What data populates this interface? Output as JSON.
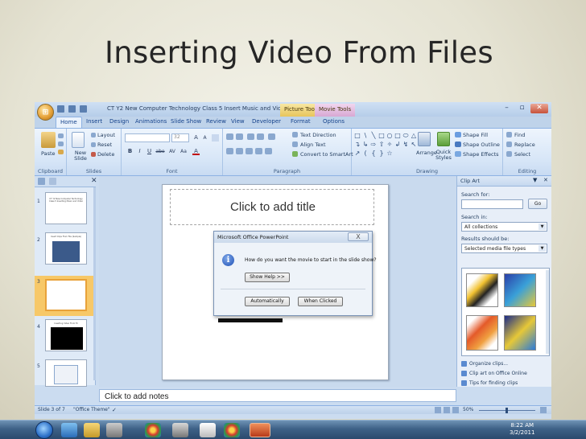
{
  "slide_title": "Inserting Video From Files",
  "window": {
    "title": "CT Y2 New Computer Technology  Class 5 Insert Music and Video ...",
    "context_tabs": [
      "Picture Tools",
      "Movie Tools"
    ],
    "controls": {
      "minimize": "–",
      "maximize": "▫",
      "close": "✕"
    }
  },
  "ribbon_tabs": [
    "Home",
    "Insert",
    "Design",
    "Animations",
    "Slide Show",
    "Review",
    "View",
    "Developer",
    "Format",
    "Options"
  ],
  "ribbon": {
    "clipboard": {
      "paste": "Paste",
      "group": "Clipboard"
    },
    "slides": {
      "new_slide": "New Slide",
      "layout": "Layout",
      "reset": "Reset",
      "delete": "Delete",
      "group": "Slides"
    },
    "font": {
      "size": "32",
      "grow": "A",
      "shrink": "A",
      "bold": "B",
      "italic": "I",
      "underline": "U",
      "strike": "abe",
      "spacing": "AV",
      "case": "Aa",
      "color": "A",
      "group": "Font"
    },
    "paragraph": {
      "text_direction": "Text Direction",
      "align_text": "Align Text",
      "smartart": "Convert to SmartArt",
      "group": "Paragraph"
    },
    "drawing": {
      "shapes_row1": [
        "□",
        "\\",
        "╲",
        "□",
        "○",
        "□",
        "⬭"
      ],
      "shapes_row2": [
        "△",
        "↴",
        "↳",
        "⇨",
        "⇧",
        "✧",
        "↲"
      ],
      "shapes_row3": [
        "↯",
        "↖",
        "↗",
        "(",
        "{",
        "}",
        "☆"
      ],
      "arrange": "Arrange",
      "quick_styles": "Quick Styles",
      "shape_fill": "Shape Fill",
      "shape_outline": "Shape Outline",
      "shape_effects": "Shape Effects",
      "group": "Drawing"
    },
    "editing": {
      "find": "Find",
      "replace": "Replace",
      "select": "Select",
      "group": "Editing"
    }
  },
  "thumbnails": [
    {
      "num": "1",
      "text": "CT Y2 New Computer Technology Class 5 Inserting Music and Video"
    },
    {
      "num": "2",
      "text": "Insert Clips From File (Sample)"
    },
    {
      "num": "3",
      "text": ""
    },
    {
      "num": "4",
      "text": "Inserting Video From Fil"
    },
    {
      "num": "5",
      "text": ""
    }
  ],
  "slide": {
    "title_placeholder": "Click to add title"
  },
  "dialog": {
    "title": "Microsoft Office PowerPoint",
    "close": "X",
    "question": "How do you want the movie to start in the slide show?",
    "show_help": "Show Help >>",
    "automatically": "Automatically",
    "when_clicked": "When Clicked"
  },
  "clipart": {
    "title": "Clip Art",
    "search_for": "Search for:",
    "go": "Go",
    "search_in": "Search in:",
    "search_in_value": "All collections",
    "results_label": "Results should be:",
    "results_value": "Selected media file types",
    "links": [
      "Organize clips...",
      "Clip art on Office Online",
      "Tips for finding clips"
    ]
  },
  "notes_placeholder": "Click to add notes",
  "status": {
    "slide": "Slide 3 of 7",
    "theme": "\"Office Theme\"",
    "zoom": "50%"
  },
  "tray": {
    "time": "8:22 AM",
    "date": "3/2/2011"
  }
}
